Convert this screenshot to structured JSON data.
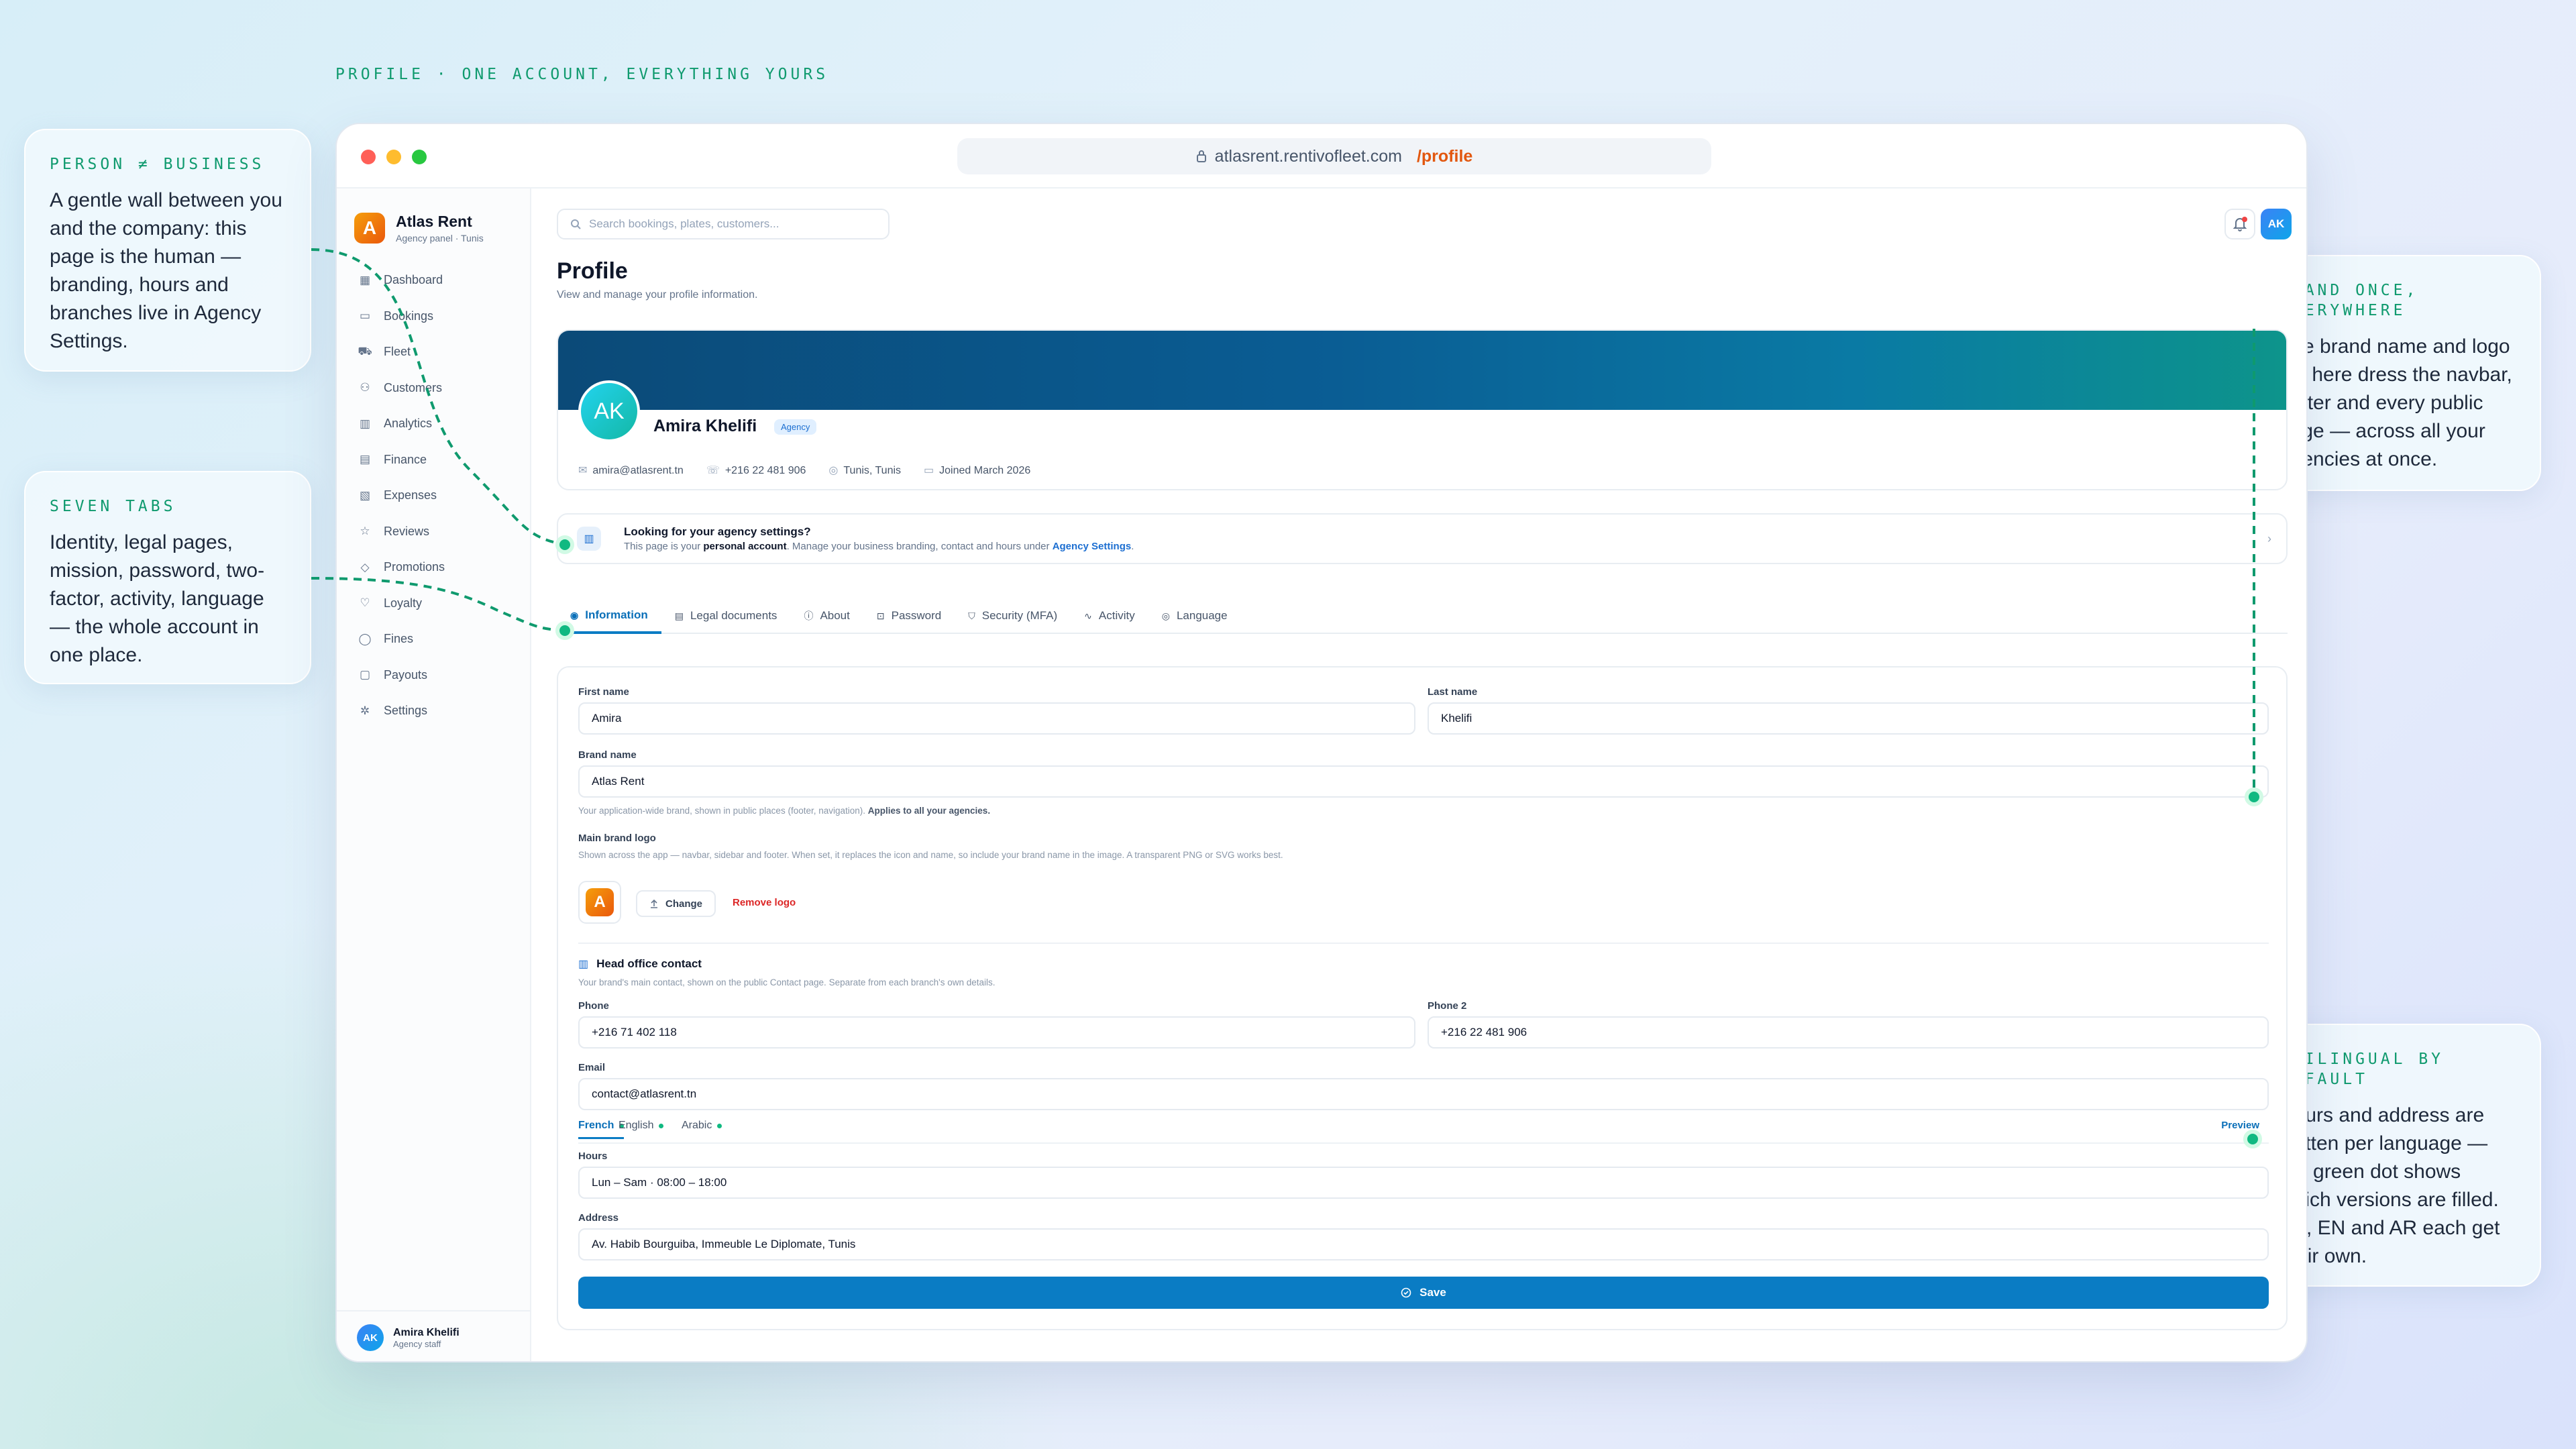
{
  "caption": "PROFILE · ONE ACCOUNT, EVERYTHING YOURS",
  "notes": {
    "person_business": {
      "kicker": "PERSON ≠ BUSINESS",
      "body": "A gentle wall between you and the company: this page is the human — branding, hours and branches live in Agency Settings."
    },
    "seven_tabs": {
      "kicker": "SEVEN TABS",
      "body": "Identity, legal pages, mission, password, two-factor, activity, language — the whole account in one place."
    },
    "brand_once": {
      "kicker": "BRAND ONCE, EVERYWHERE",
      "body": "The brand name and logo set here dress the navbar, footer and every public page — across all your agencies at once."
    },
    "trilingual": {
      "kicker": "TRILINGUAL BY DEFAULT",
      "body": "Hours and address are written per language — the green dot shows which versions are filled. FR, EN and AR each get their own."
    }
  },
  "browser": {
    "url_host": "atlasrent.rentivofleet.com",
    "url_path": "/profile"
  },
  "sidebar": {
    "brand_name": "Atlas Rent",
    "brand_sub": "Agency panel · Tunis",
    "brand_initial": "A",
    "items": [
      {
        "label": "Dashboard",
        "icon": "▦"
      },
      {
        "label": "Bookings",
        "icon": "▭"
      },
      {
        "label": "Fleet",
        "icon": "⛟"
      },
      {
        "label": "Customers",
        "icon": "⚇"
      },
      {
        "label": "Analytics",
        "icon": "▥"
      },
      {
        "label": "Finance",
        "icon": "▤"
      },
      {
        "label": "Expenses",
        "icon": "▧"
      },
      {
        "label": "Reviews",
        "icon": "☆"
      },
      {
        "label": "Promotions",
        "icon": "◇"
      },
      {
        "label": "Loyalty",
        "icon": "♡"
      },
      {
        "label": "Fines",
        "icon": "◯"
      },
      {
        "label": "Payouts",
        "icon": "▢"
      },
      {
        "label": "Settings",
        "icon": "✲"
      }
    ],
    "user_name": "Amira Khelifi",
    "user_role": "Agency staff",
    "user_initials": "AK"
  },
  "header": {
    "search_placeholder": "Search bookings, plates, customers...",
    "avatar": "AK"
  },
  "page": {
    "title": "Profile",
    "subtitle": "View and manage your profile information."
  },
  "profile": {
    "initials": "AK",
    "name": "Amira Khelifi",
    "badge": "Agency",
    "email": "amira@atlasrent.tn",
    "phone": "+216 22 481 906",
    "location": "Tunis, Tunis",
    "joined": "Joined March 2026"
  },
  "info": {
    "title": "Looking for your agency settings?",
    "text_pre": "This page is your ",
    "text_bold": "personal account",
    "text_mid": ". Manage your business branding, contact and hours under ",
    "text_link": "Agency Settings",
    "text_end": "."
  },
  "tabs": [
    "Information",
    "Legal documents",
    "About",
    "Password",
    "Security (MFA)",
    "Activity",
    "Language"
  ],
  "form": {
    "first_name_label": "First name",
    "first_name": "Amira",
    "last_name_label": "Last name",
    "last_name": "Khelifi",
    "brand_label": "Brand name",
    "brand": "Atlas Rent",
    "brand_hint": "Your application-wide brand, shown in public places (footer, navigation). ",
    "brand_hint_bold": "Applies to all your agencies.",
    "logo_label": "Main brand logo",
    "logo_hint": "Shown across the app — navbar, sidebar and footer. When set, it replaces the icon and name, so include your brand name in the image. A transparent PNG or SVG works best.",
    "change_btn": "Change",
    "remove_btn": "Remove logo",
    "contact_title": "Head office contact",
    "contact_hint": "Your brand's main contact, shown on the public Contact page. Separate from each branch's own details.",
    "phone_label": "Phone",
    "phone": "+216 71 402 118",
    "phone2_label": "Phone 2",
    "phone2": "+216 22 481 906",
    "email_label": "Email",
    "email": "contact@atlasrent.tn",
    "lang_tabs": [
      "French",
      "English",
      "Arabic"
    ],
    "preview": "Preview",
    "hours_label": "Hours",
    "hours": "Lun – Sam · 08:00 – 18:00",
    "address_label": "Address",
    "address": "Av. Habib Bourguiba, Immeuble Le Diplomate, Tunis",
    "save": "Save"
  },
  "colors": {
    "accent": "#0a7cc4",
    "annotation": "#0f9a6e",
    "brand_orange": "#ea580c"
  }
}
